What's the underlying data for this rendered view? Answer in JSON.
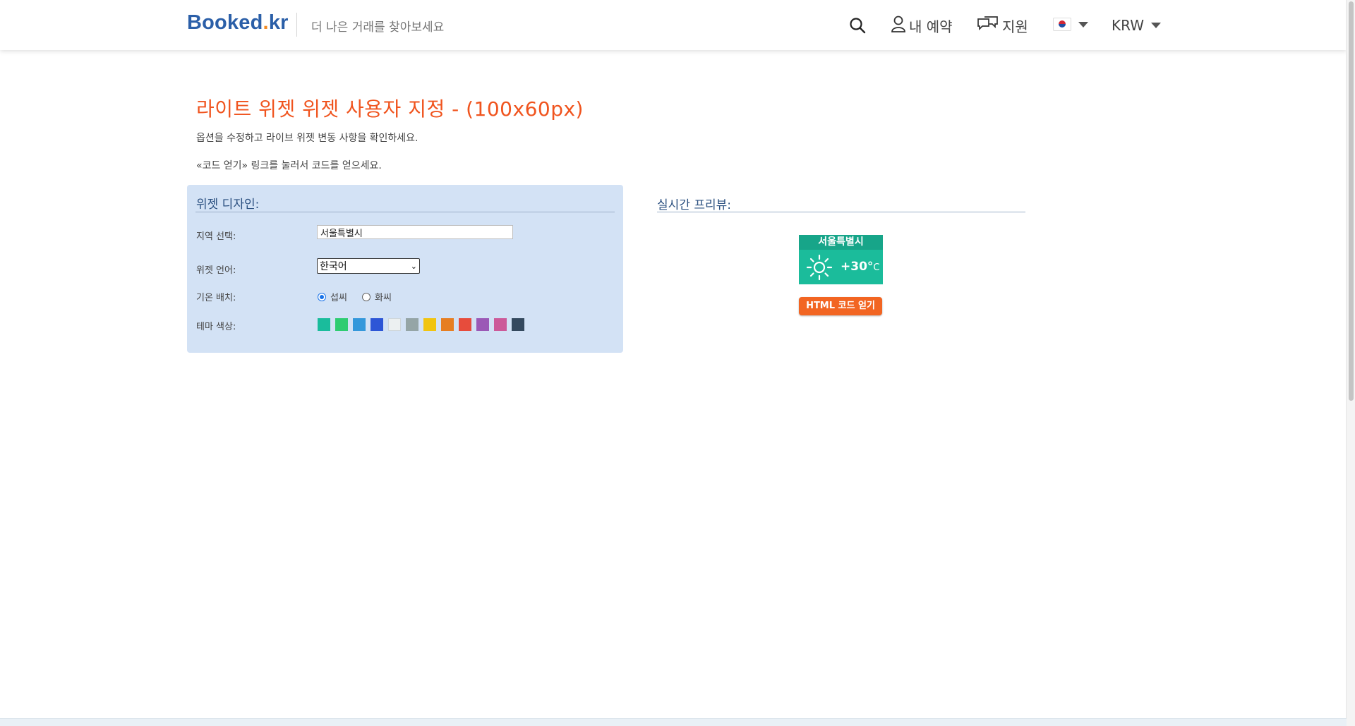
{
  "header": {
    "logo_main": "Booked",
    "logo_dot": ".",
    "logo_tld": "kr",
    "tagline": "더 나은 거래를 찾아보세요",
    "my_booking": "내 예약",
    "support": "지원",
    "currency": "KRW",
    "icons": [
      "search-icon",
      "user-icon",
      "chat-icon",
      "flag-kr-icon"
    ]
  },
  "page": {
    "title": "라이트 위젯 위젯 사용자 지정 - (100x60px)",
    "intro_1": "옵션을 수정하고 라이브 위젯 변동 사항을 확인하세요.",
    "intro_2": "«코드 얻기» 링크를 눌러서 코드를 얻으세요."
  },
  "design": {
    "title": "위젯 디자인:",
    "city_label": "지역 선택:",
    "city_value": "서울특별시",
    "lang_label": "위젯 언어:",
    "lang_value": "한국어",
    "temp_label": "기온 배치:",
    "temp_options": [
      "섭씨",
      "화씨"
    ],
    "temp_selected": "섭씨",
    "theme_label": "테마 색상:",
    "theme_colors": [
      "#1abc9c",
      "#2ecc71",
      "#3498db",
      "#2d56d6",
      "#ecf0f1",
      "#95a5a6",
      "#f1c40f",
      "#e67e22",
      "#e74c3c",
      "#9b59b6",
      "#cc5a99",
      "#34495e"
    ]
  },
  "preview": {
    "title": "실시간 프리뷰:",
    "widget_city": "서울특별시",
    "widget_temp": "+30°",
    "widget_unit": "C",
    "widget_icon": "sun-icon",
    "get_code": "HTML 코드 얻기"
  }
}
